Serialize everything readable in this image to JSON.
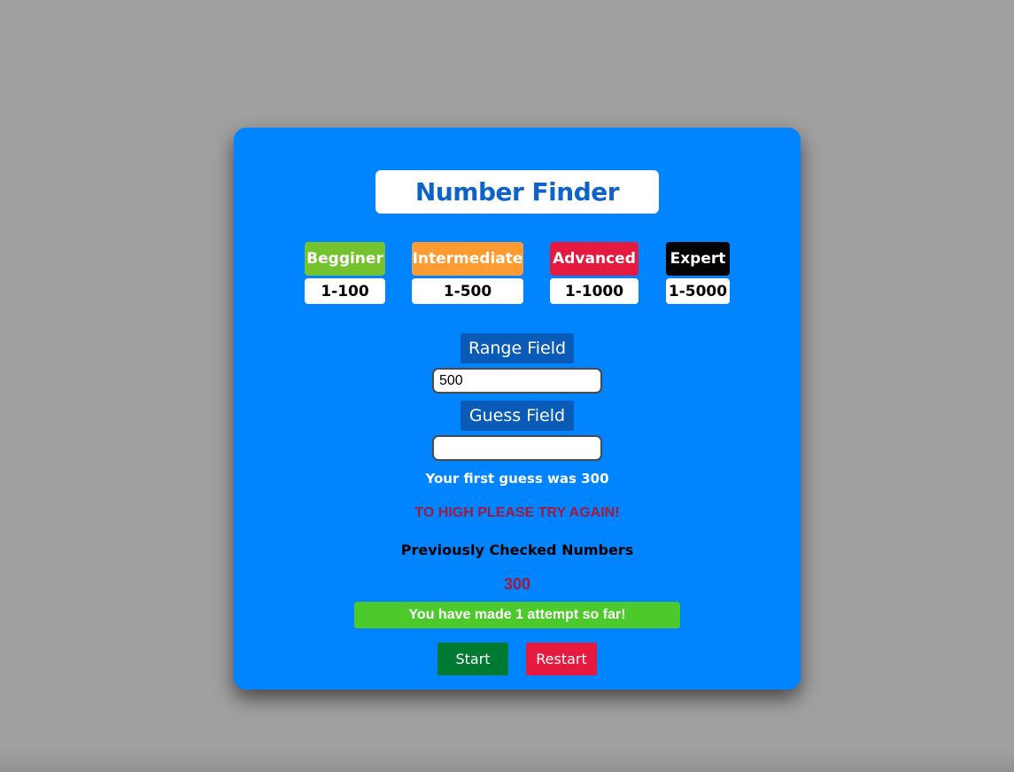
{
  "app": {
    "title": "Number Finder"
  },
  "levels": [
    {
      "name": "Begginer",
      "range": "1-100",
      "color": "#73c22e"
    },
    {
      "name": "Intermediate",
      "range": "1-500",
      "color": "#ff9b30"
    },
    {
      "name": "Advanced",
      "range": "1-1000",
      "color": "#e6193f"
    },
    {
      "name": "Expert",
      "range": "1-5000",
      "color": "#000000"
    }
  ],
  "range_field": {
    "label": "Range Field",
    "value": "500"
  },
  "guess_field": {
    "label": "Guess Field",
    "value": ""
  },
  "status": {
    "first_guess": "Your first guess was 300",
    "feedback": "TO HIGH PLEASE TRY AGAIN!",
    "previous_heading": "Previously Checked Numbers",
    "previous_numbers": "300",
    "attempts": "You have made 1 attempt so far!"
  },
  "buttons": {
    "start": {
      "label": "Start",
      "color": "#007a33"
    },
    "restart": {
      "label": "Restart",
      "color": "#e6193f"
    }
  },
  "colors": {
    "background": "#a0a0a0",
    "card": "#0084ff",
    "title_text": "#0e63c8",
    "field_label_bg": "#0a5bb8",
    "feedback_text": "#a31a3c",
    "attempts_bg": "#4cc92b"
  }
}
